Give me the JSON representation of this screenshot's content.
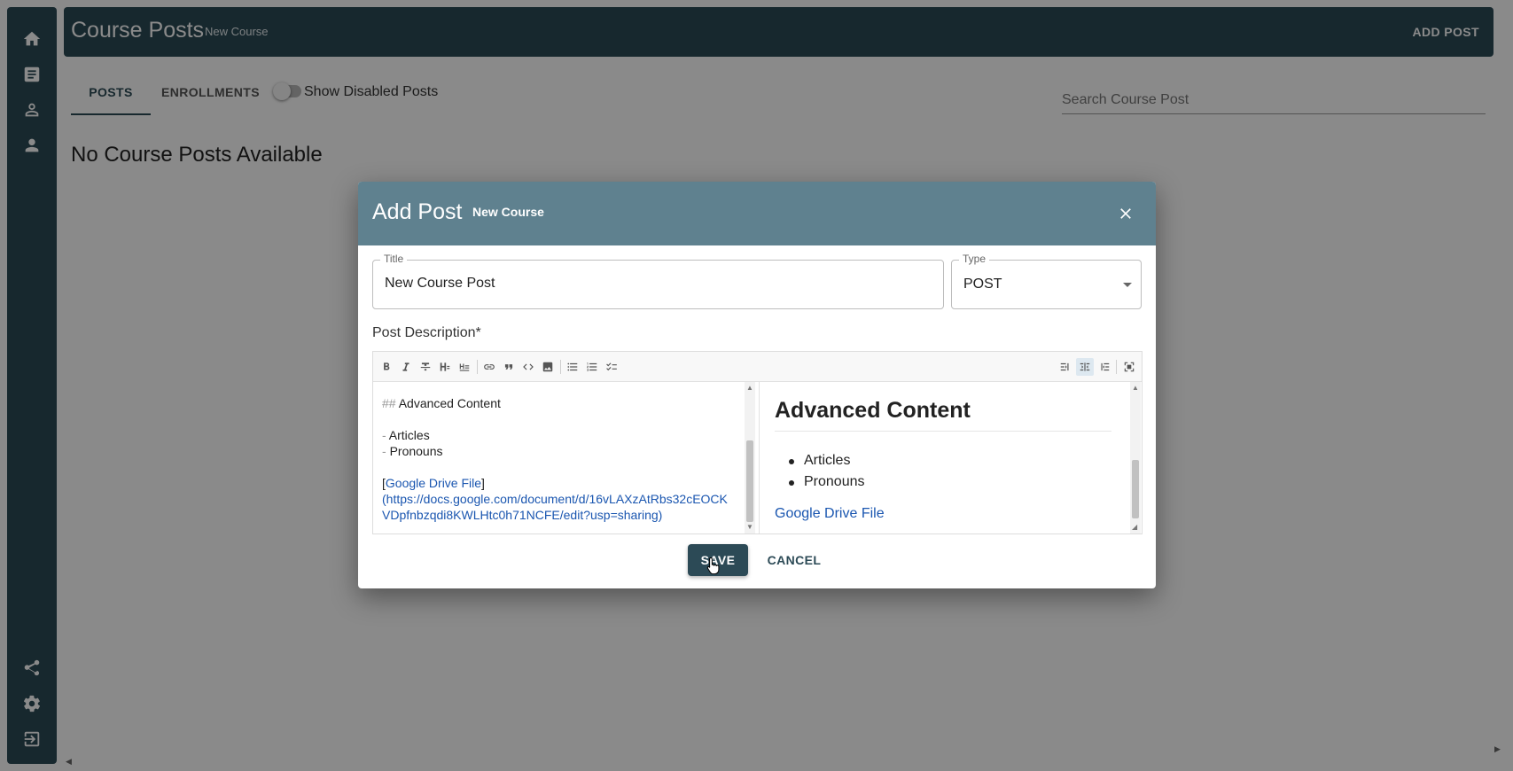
{
  "sidebar": {
    "items": [
      {
        "name": "home-icon"
      },
      {
        "name": "document-icon"
      },
      {
        "name": "account-outline-icon"
      },
      {
        "name": "account-icon"
      },
      {
        "name": "share-icon"
      },
      {
        "name": "settings-gear-icon"
      },
      {
        "name": "logout-icon"
      }
    ]
  },
  "header": {
    "title": "Course Posts",
    "subtitle": "New Course",
    "add_post_label": "ADD POST"
  },
  "tabs": [
    {
      "label": "POSTS",
      "active": true
    },
    {
      "label": "ENROLLMENTS",
      "active": false
    }
  ],
  "toggle": {
    "label": "Show Disabled Posts",
    "on": false
  },
  "search": {
    "placeholder": "Search Course Post",
    "value": ""
  },
  "main": {
    "empty_message": "No Course Posts Available"
  },
  "dialog": {
    "title": "Add Post",
    "subtitle": "New Course",
    "title_field": {
      "label": "Title",
      "value": "New Course Post"
    },
    "type_field": {
      "label": "Type",
      "value": "POST"
    },
    "description_label": "Post Description*",
    "toolbar_icons": [
      "bold-icon",
      "italic-icon",
      "strikethrough-icon",
      "heading-icon",
      "heading-smaller-icon",
      "link-icon",
      "quote-icon",
      "code-icon",
      "image-icon",
      "unordered-list-icon",
      "ordered-list-icon",
      "checklist-icon",
      "edit-only-icon",
      "side-by-side-icon",
      "preview-only-icon",
      "fullscreen-icon"
    ],
    "editor_source": {
      "heading_mark": "##",
      "heading_text": "Advanced Content",
      "list_mark_1": "-",
      "list_item_1": "Articles",
      "list_mark_2": "-",
      "list_item_2": "Pronouns",
      "link_open": "[",
      "link_text": "Google Drive File",
      "link_close": "]",
      "url_line_1": "(https://docs.google.com/document/d/16vLAXzAtRbs32cEOCK",
      "url_line_2": "VDpfnbzqdi8KWLHtc0h71NCFE/edit?usp=sharing)"
    },
    "preview": {
      "heading": "Advanced Content",
      "items": [
        "Articles",
        "Pronouns"
      ],
      "link_text": "Google Drive File"
    },
    "save_label": "SAVE",
    "cancel_label": "CANCEL"
  },
  "colors": {
    "primary": "#2c4a56",
    "dialog_header": "#5f818f",
    "link": "#1a56b0"
  }
}
